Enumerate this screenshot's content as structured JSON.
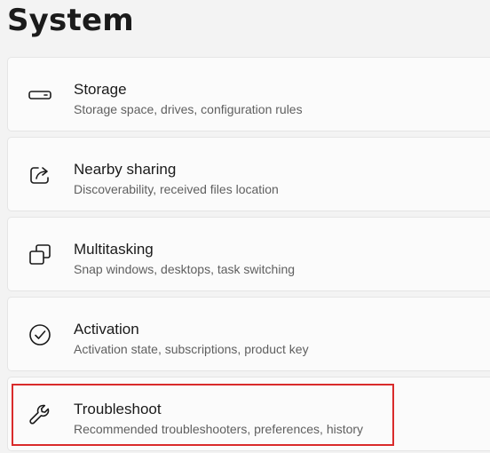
{
  "page": {
    "title": "System"
  },
  "items": [
    {
      "icon": "storage-drive-icon",
      "title": "Storage",
      "description": "Storage space, drives, configuration rules"
    },
    {
      "icon": "share-icon",
      "title": "Nearby sharing",
      "description": "Discoverability, received files location"
    },
    {
      "icon": "multitasking-windows-icon",
      "title": "Multitasking",
      "description": "Snap windows, desktops, task switching"
    },
    {
      "icon": "activation-check-icon",
      "title": "Activation",
      "description": "Activation state, subscriptions, product key"
    },
    {
      "icon": "wrench-icon",
      "title": "Troubleshoot",
      "description": "Recommended troubleshooters, preferences, history",
      "highlighted": true
    }
  ],
  "colors": {
    "background": "#f3f3f3",
    "card": "#fbfbfb",
    "card_border": "#e5e5e5",
    "highlight": "#d92b2b"
  }
}
